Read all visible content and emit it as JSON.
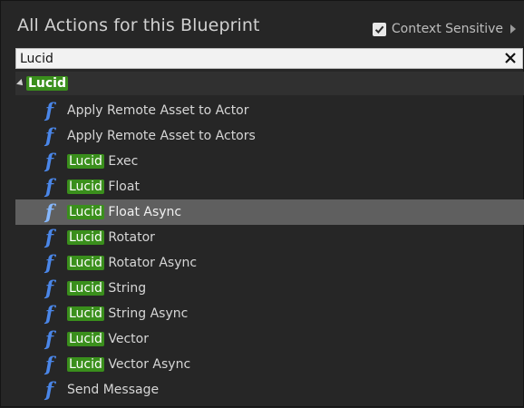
{
  "header": {
    "title": "All Actions for this Blueprint",
    "context_sensitive_label": "Context Sensitive",
    "context_sensitive_checked": true
  },
  "search": {
    "value": "Lucid",
    "placeholder": ""
  },
  "category": {
    "label": "Lucid",
    "expanded": true
  },
  "colors": {
    "highlight": "#3a8f1c",
    "function_icon": "#4a86e8",
    "selected_row": "#5f5f5f"
  },
  "items": [
    {
      "prefix": "",
      "rest": "Apply Remote Asset to Actor",
      "icon": "function-icon"
    },
    {
      "prefix": "",
      "rest": "Apply Remote Asset to Actors",
      "icon": "function-icon"
    },
    {
      "prefix": "Lucid",
      "rest": " Exec",
      "icon": "function-icon"
    },
    {
      "prefix": "Lucid",
      "rest": " Float",
      "icon": "function-icon"
    },
    {
      "prefix": "Lucid",
      "rest": " Float Async",
      "icon": "function-icon",
      "selected": true
    },
    {
      "prefix": "Lucid",
      "rest": " Rotator",
      "icon": "function-icon"
    },
    {
      "prefix": "Lucid",
      "rest": " Rotator Async",
      "icon": "function-icon"
    },
    {
      "prefix": "Lucid",
      "rest": " String",
      "icon": "function-icon"
    },
    {
      "prefix": "Lucid",
      "rest": " String Async",
      "icon": "function-icon"
    },
    {
      "prefix": "Lucid",
      "rest": " Vector",
      "icon": "function-icon"
    },
    {
      "prefix": "Lucid",
      "rest": " Vector Async",
      "icon": "function-icon"
    },
    {
      "prefix": "",
      "rest": "Send Message",
      "icon": "function-icon"
    }
  ]
}
